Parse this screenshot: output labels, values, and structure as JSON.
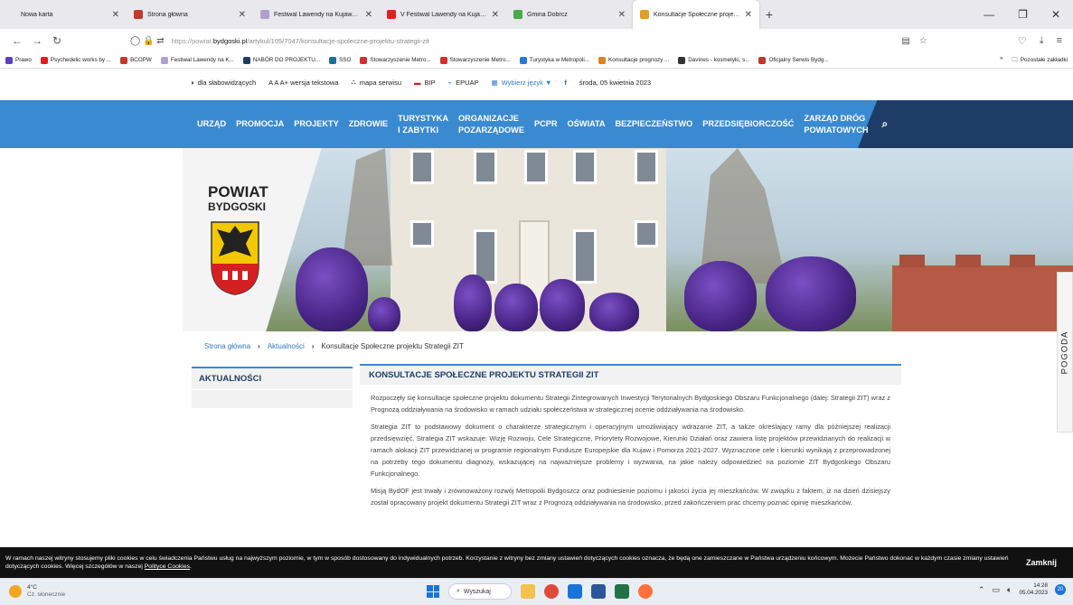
{
  "browser": {
    "tabs": [
      {
        "label": "Nowa karta",
        "favicon_color": "#ffffff",
        "active": false
      },
      {
        "label": "Strona główna",
        "favicon_color": "#c0392b",
        "active": false
      },
      {
        "label": "Festiwal Lawendy na Kujawach",
        "favicon_color": "#b0a0d0",
        "active": false
      },
      {
        "label": "V Festiwal Lawendy na Kujawa",
        "favicon_color": "#e02020",
        "active": false
      },
      {
        "label": "Gmina Dobrcz",
        "favicon_color": "#4aa84a",
        "active": false
      },
      {
        "label": "Konsultacje Społeczne projektu",
        "favicon_color": "#e0a020",
        "active": true
      }
    ],
    "url_domain": "https://powiat.bydgoski.pl",
    "url_domain_bold": "bydgoski.pl",
    "url_prefix": "https://powiat.",
    "url_path": "/artykul/105/7047/konsultacje-spoleczne-projektu-strategii-zit",
    "bookmarks": [
      {
        "label": "Prawo",
        "color": "#5a3fc0"
      },
      {
        "label": "Psychedelic works by ...",
        "color": "#e02020"
      },
      {
        "label": "BCOPW",
        "color": "#c0392b"
      },
      {
        "label": "Festiwal Lawendy na K...",
        "color": "#b0a0d0"
      },
      {
        "label": "NABÓR DO PROJEKTU...",
        "color": "#1d3d66"
      },
      {
        "label": "SSO",
        "color": "#1d6f9a"
      },
      {
        "label": "Stowarzyszenie Metro...",
        "color": "#d03030"
      },
      {
        "label": "Stowarzyszenie Metro...",
        "color": "#d03030"
      },
      {
        "label": "Turystyka w Metropoli...",
        "color": "#2a7ad0"
      },
      {
        "label": "Konsultacje prognozy ...",
        "color": "#e08020"
      },
      {
        "label": "Davines - kosmetyki, s...",
        "color": "#333333"
      },
      {
        "label": "Oficjalny Serwis Bydg...",
        "color": "#c0392b"
      }
    ],
    "bookmarks_more": "»",
    "other_bookmarks": "Pozostałe zakładki"
  },
  "access_bar": {
    "items": [
      {
        "label": "dla słabowidzących"
      },
      {
        "label": "A A A+ wersja tekstowa"
      },
      {
        "label": "mapa serwisu"
      },
      {
        "label": "BIP"
      },
      {
        "label": "EPUAP"
      },
      {
        "label": "Wybierz język ▼"
      },
      {
        "label": "środa, 05 kwietnia 2023"
      }
    ]
  },
  "mainnav": {
    "items": [
      {
        "line1": "URZĄD",
        "line2": ""
      },
      {
        "line1": "PROMOCJA",
        "line2": ""
      },
      {
        "line1": "PROJEKTY",
        "line2": ""
      },
      {
        "line1": "ZDROWIE",
        "line2": ""
      },
      {
        "line1": "TURYSTYKA",
        "line2": "I ZABYTKI"
      },
      {
        "line1": "ORGANIZACJE",
        "line2": "POZARZĄDOWE"
      },
      {
        "line1": "PCPR",
        "line2": ""
      },
      {
        "line1": "OŚWIATA",
        "line2": ""
      },
      {
        "line1": "BEZPIECZEŃSTWO",
        "line2": ""
      },
      {
        "line1": "PRZEDSIĘBIORCZOŚĆ",
        "line2": ""
      },
      {
        "line1": "ZARZĄD DRÓG",
        "line2": "POWIATOWYCH"
      }
    ],
    "colors": {
      "primary": "#3a8ad2",
      "dark": "#1d3d66"
    }
  },
  "logo": {
    "line1": "POWIAT",
    "line2": "BYDGOSKI"
  },
  "weather_tab": "POGODA",
  "breadcrumb": {
    "home": "Strona główna",
    "section": "Aktualności",
    "current": "Konsultacje Społeczne projektu Strategii ZIT"
  },
  "sidebar": {
    "title": "AKTUALNOŚCI"
  },
  "article": {
    "title": "KONSULTACJE SPOŁECZNE PROJEKTU STRATEGII ZIT",
    "paragraphs": [
      "Rozpoczęły się konsultacje społeczne projektu dokumentu Strategii Zintegrowanych Inwestycji Terytorialnych Bydgoskiego Obszaru Funkcjonalnego (dalej: Strategii ZIT) wraz z Prognozą oddziaływania na środowisko w ramach udziału społeczeństwa w strategicznej ocenie oddziaływania na środowisko.",
      "Strategia ZIT to podstawowy dokument o charakterze strategicznym i operacyjnym umożliwiający wdrażanie ZIT, a także określający ramy dla późniejszej realizacji przedsięwzięć. Strategia ZIT wskazuje: Wizję Rozwoju, Cele Strategiczne, Priorytety Rozwojowe, Kierunki Działań oraz zawiera listę projektów przewidzianych do realizacji w ramach alokacji ZIT przewidzianej w programie regionalnym Fundusze Europejskie dla Kujaw i Pomorza 2021-2027. Wyznaczone cele i kierunki wynikają z przeprowadzonej na potrzeby tego dokumentu diagnozy, wskazującej na najważniejsze problemy i wyzwania, na jakie należy odpowiedzieć na poziomie ZIT Bydgoskiego Obszaru Funkcjonalnego.",
      "Misją BydOF jest trwały i zrównoważony rozwój Metropolii Bydgoszcz oraz podniesienie poziomu i jakości życia jej mieszkańców. W związku z faktem, iż na dzień dzisiejszy został opracowany projekt dokumentu Strategii ZIT wraz z Prognozą oddziaływania na środowisko, przed zakończeniem prac chcemy poznać opinię mieszkańców."
    ]
  },
  "cookie": {
    "text": "W ramach naszej witryny stosujemy pliki cookies w celu świadczenia Państwu usług na najwyższym poziomie, w tym w sposób dostosowany do indywidualnych potrzeb. Korzystanie z witryny bez zmiany ustawień dotyczących cookies oznacza, że będą one zamieszczane w Państwa urządzeniu końcowym. Możecie Państwo dokonać w każdym czasie zmiany ustawień dotyczących cookies. Więcej szczegółów w naszej ",
    "link": "Polityce Cookies",
    "tail": ".",
    "close": "Zamknij"
  },
  "taskbar": {
    "temp": "4°C",
    "weather": "Cz. słonecznie",
    "search": "Wyszukaj",
    "time": "14:28",
    "date": "05.04.2023",
    "notif_count": "20"
  }
}
